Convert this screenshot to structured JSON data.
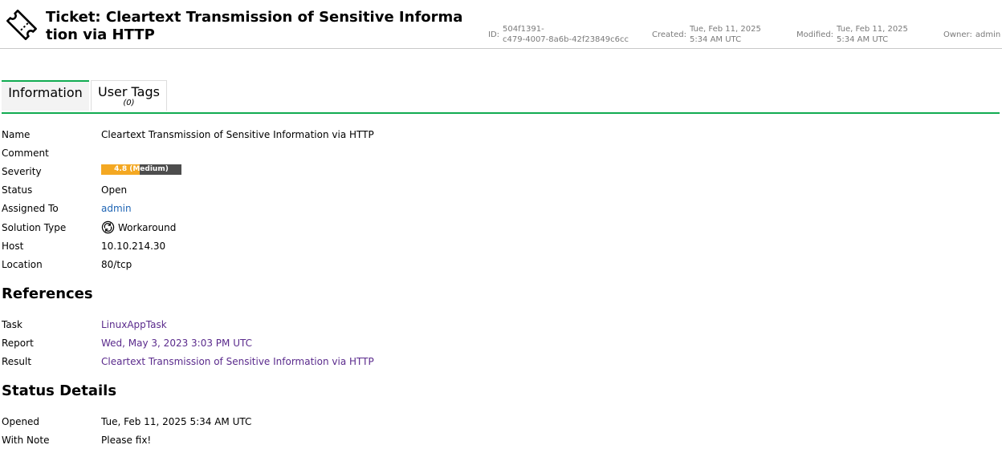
{
  "header": {
    "title": "Ticket: Cleartext Transmission of Sensitive Information via HTTP",
    "id_label": "ID:",
    "id_line1": "504f1391-",
    "id_line2": "c479-4007-8a6b-42f23849c6cc",
    "created_label": "Created:",
    "created_line1": "Tue, Feb 11, 2025",
    "created_line2": "5:34 AM UTC",
    "modified_label": "Modified:",
    "modified_line1": "Tue, Feb 11, 2025",
    "modified_line2": "5:34 AM UTC",
    "owner_label": "Owner:",
    "owner_value": "admin"
  },
  "tabs": {
    "information": "Information",
    "user_tags": "User Tags",
    "user_tags_count": "(0)"
  },
  "info": {
    "name_label": "Name",
    "name_value": "Cleartext Transmission of Sensitive Information via HTTP",
    "comment_label": "Comment",
    "severity_label": "Severity",
    "severity_text": "4.8 (Medium)",
    "severity_score": 4.8,
    "severity_max": 10,
    "status_label": "Status",
    "status_value": "Open",
    "assigned_label": "Assigned To",
    "assigned_value": "admin",
    "solution_label": "Solution Type",
    "solution_value": "Workaround",
    "host_label": "Host",
    "host_value": "10.10.214.30",
    "location_label": "Location",
    "location_value": "80/tcp"
  },
  "references": {
    "heading": "References",
    "task_label": "Task",
    "task_value": "LinuxAppTask",
    "report_label": "Report",
    "report_value": "Wed, May 3, 2023 3:03 PM UTC",
    "result_label": "Result",
    "result_value": "Cleartext Transmission of Sensitive Information via HTTP"
  },
  "status_details": {
    "heading": "Status Details",
    "opened_label": "Opened",
    "opened_value": "Tue, Feb 11, 2025 5:34 AM UTC",
    "note_label": "With Note",
    "note_value": "Please fix!"
  },
  "colors": {
    "tab_accent": "#11ab51",
    "severity_medium": "#f4a822",
    "link": "#1e64b4",
    "visited_link": "#5a2a8c"
  },
  "icons": {
    "header": "ticket-icon",
    "solution": "workaround-icon"
  }
}
